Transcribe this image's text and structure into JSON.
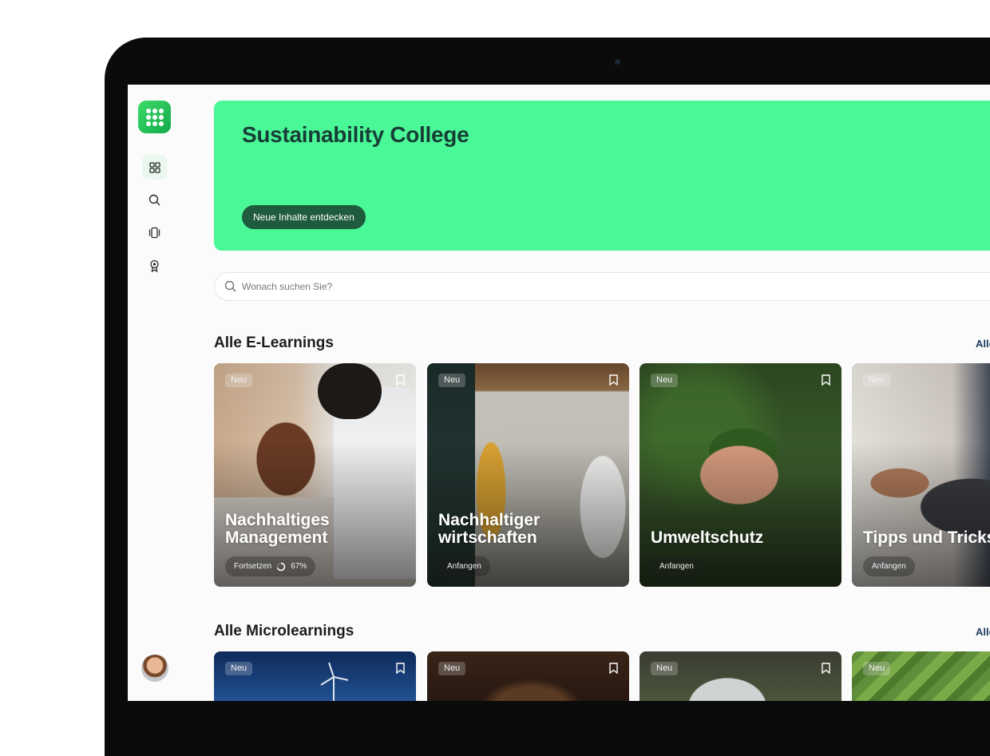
{
  "sidebar": {
    "items": [
      {
        "name": "grid-icon"
      },
      {
        "name": "search-icon"
      },
      {
        "name": "cards-icon"
      },
      {
        "name": "award-icon"
      }
    ]
  },
  "hero": {
    "title": "Sustainability College",
    "button_label": "Neue Inhalte entdecken",
    "color": "#4af897"
  },
  "search": {
    "placeholder": "Wonach suchen Sie?"
  },
  "elearnings": {
    "title": "Alle E-Learnings",
    "see_all": "Alle",
    "cards": [
      {
        "badge": "Neu",
        "title": "Nachhaltiges Management",
        "action": "Fortsetzen",
        "progress": "67%",
        "progress_value": 0.67
      },
      {
        "badge": "Neu",
        "title": "Nachhaltiger wirtschaften",
        "action": "Anfangen"
      },
      {
        "badge": "Neu",
        "title": "Umweltschutz",
        "action": "Anfangen"
      },
      {
        "badge": "Neu",
        "title": "Tipps und Tricks",
        "action": "Anfangen"
      }
    ]
  },
  "microlearnings": {
    "title": "Alle Microlearnings",
    "see_all": "Alle",
    "cards": [
      {
        "badge": "Neu"
      },
      {
        "badge": "Neu"
      },
      {
        "badge": "Neu"
      },
      {
        "badge": "Neu"
      }
    ]
  }
}
